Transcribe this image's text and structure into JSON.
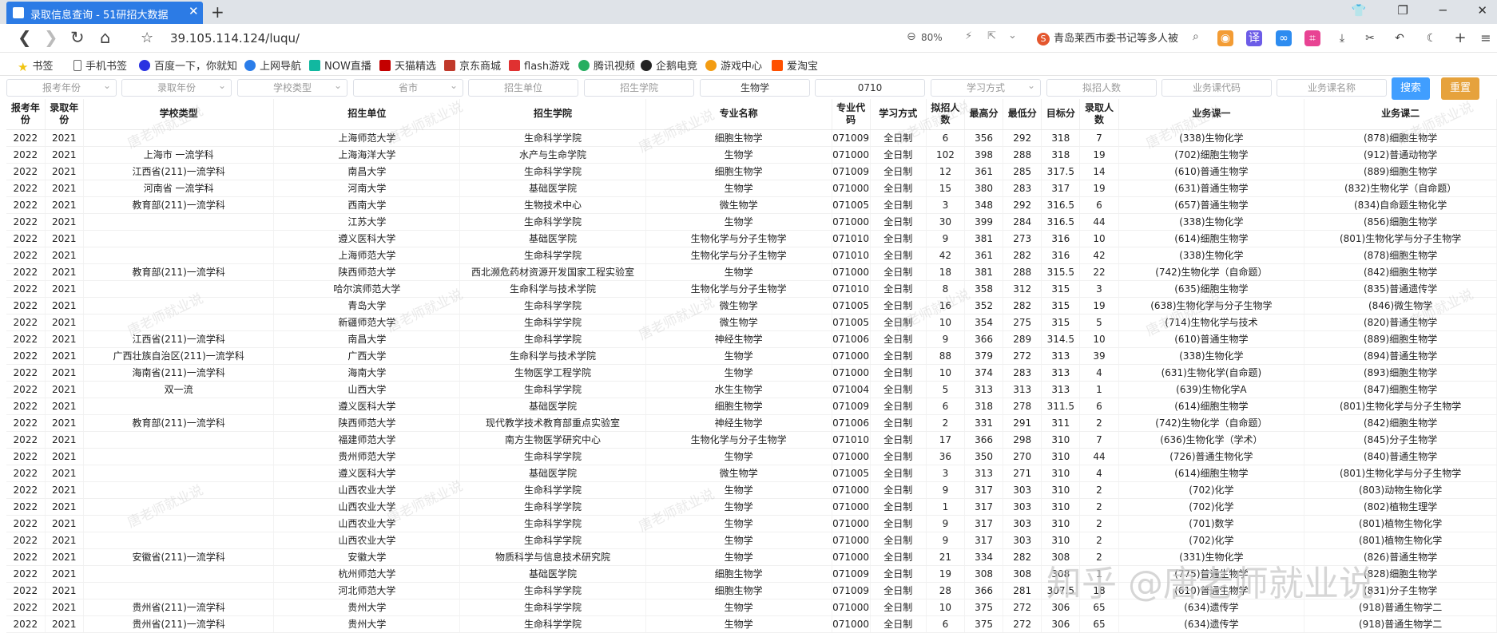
{
  "browser": {
    "tab_title": "录取信息查询 - 51研招大数据",
    "url": "39.105.114.124/luqu/",
    "zoom": "80%",
    "search_text": "青岛莱西市委书记等多人被"
  },
  "bookmarks": [
    "书签",
    "手机书签",
    "百度一下，你就知",
    "上网导航",
    "NOW直播",
    "天猫精选",
    "京东商城",
    "flash游戏",
    "腾讯视频",
    "企鹅电竞",
    "游戏中心",
    "爱淘宝"
  ],
  "filters": {
    "exam_year": "报考年份",
    "admit_year": "录取年份",
    "school_type": "学校类型",
    "province": "省市",
    "unit": "招生单位",
    "college": "招生学院",
    "major_name": "生物学",
    "major_code": "0710",
    "study_mode": "学习方式",
    "plan_count": "拟招人数",
    "course_code": "业务课代码",
    "course_name": "业务课名称",
    "search_btn": "搜索",
    "reset_btn": "重置"
  },
  "table": {
    "headers": [
      "报考年份",
      "录取年份",
      "学校类型",
      "招生单位",
      "招生学院",
      "专业名称",
      "专业代码",
      "学习方式",
      "拟招人数",
      "最高分",
      "最低分",
      "目标分",
      "录取人数",
      "业务课一",
      "业务课二"
    ],
    "rows": [
      [
        "2022",
        "2021",
        "",
        "上海师范大学",
        "生命科学学院",
        "细胞生物学",
        "071009",
        "全日制",
        "6",
        "356",
        "292",
        "318",
        "7",
        "(338)生物化学",
        "(878)细胞生物学"
      ],
      [
        "2022",
        "2021",
        "上海市 一流学科",
        "上海海洋大学",
        "水产与生命学院",
        "生物学",
        "071000",
        "全日制",
        "102",
        "398",
        "288",
        "318",
        "19",
        "(702)细胞生物学",
        "(912)普通动物学"
      ],
      [
        "2022",
        "2021",
        "江西省(211)一流学科",
        "南昌大学",
        "生命科学学院",
        "细胞生物学",
        "071009",
        "全日制",
        "12",
        "361",
        "285",
        "317.5",
        "14",
        "(610)普通生物学",
        "(889)细胞生物学"
      ],
      [
        "2022",
        "2021",
        "河南省 一流学科",
        "河南大学",
        "基础医学院",
        "生物学",
        "071000",
        "全日制",
        "15",
        "380",
        "283",
        "317",
        "19",
        "(631)普通生物学",
        "(832)生物化学（自命题）"
      ],
      [
        "2022",
        "2021",
        "教育部(211)一流学科",
        "西南大学",
        "生物技术中心",
        "微生物学",
        "071005",
        "全日制",
        "3",
        "348",
        "292",
        "316.5",
        "6",
        "(657)普通生物学",
        "(834)自命题生物化学"
      ],
      [
        "2022",
        "2021",
        "",
        "江苏大学",
        "生命科学学院",
        "生物学",
        "071000",
        "全日制",
        "30",
        "399",
        "284",
        "316.5",
        "44",
        "(338)生物化学",
        "(856)细胞生物学"
      ],
      [
        "2022",
        "2021",
        "",
        "遵义医科大学",
        "基础医学院",
        "生物化学与分子生物学",
        "071010",
        "全日制",
        "9",
        "381",
        "273",
        "316",
        "10",
        "(614)细胞生物学",
        "(801)生物化学与分子生物学"
      ],
      [
        "2022",
        "2021",
        "",
        "上海师范大学",
        "生命科学学院",
        "生物化学与分子生物学",
        "071010",
        "全日制",
        "42",
        "361",
        "282",
        "316",
        "42",
        "(338)生物化学",
        "(878)细胞生物学"
      ],
      [
        "2022",
        "2021",
        "教育部(211)一流学科",
        "陕西师范大学",
        "西北濒危药材资源开发国家工程实验室",
        "生物学",
        "071000",
        "全日制",
        "18",
        "381",
        "288",
        "315.5",
        "22",
        "(742)生物化学（自命题）",
        "(842)细胞生物学"
      ],
      [
        "2022",
        "2021",
        "",
        "哈尔滨师范大学",
        "生命科学与技术学院",
        "生物化学与分子生物学",
        "071010",
        "全日制",
        "8",
        "358",
        "312",
        "315",
        "3",
        "(635)细胞生物学",
        "(835)普通遗传学"
      ],
      [
        "2022",
        "2021",
        "",
        "青岛大学",
        "生命科学学院",
        "微生物学",
        "071005",
        "全日制",
        "16",
        "352",
        "282",
        "315",
        "19",
        "(638)生物化学与分子生物学",
        "(846)微生物学"
      ],
      [
        "2022",
        "2021",
        "",
        "新疆师范大学",
        "生命科学学院",
        "微生物学",
        "071005",
        "全日制",
        "10",
        "354",
        "275",
        "315",
        "5",
        "(714)生物化学与技术",
        "(820)普通生物学"
      ],
      [
        "2022",
        "2021",
        "江西省(211)一流学科",
        "南昌大学",
        "生命科学学院",
        "神经生物学",
        "071006",
        "全日制",
        "9",
        "366",
        "289",
        "314.5",
        "10",
        "(610)普通生物学",
        "(889)细胞生物学"
      ],
      [
        "2022",
        "2021",
        "广西壮族自治区(211)一流学科",
        "广西大学",
        "生命科学与技术学院",
        "生物学",
        "071000",
        "全日制",
        "88",
        "379",
        "272",
        "313",
        "39",
        "(338)生物化学",
        "(894)普通生物学"
      ],
      [
        "2022",
        "2021",
        "海南省(211)一流学科",
        "海南大学",
        "生物医学工程学院",
        "生物学",
        "071000",
        "全日制",
        "10",
        "374",
        "283",
        "313",
        "4",
        "(631)生物化学(自命题)",
        "(893)细胞生物学"
      ],
      [
        "2022",
        "2021",
        "双一流",
        "山西大学",
        "生命科学学院",
        "水生生物学",
        "071004",
        "全日制",
        "5",
        "313",
        "313",
        "313",
        "1",
        "(639)生物化学A",
        "(847)细胞生物学"
      ],
      [
        "2022",
        "2021",
        "",
        "遵义医科大学",
        "基础医学院",
        "细胞生物学",
        "071009",
        "全日制",
        "6",
        "318",
        "278",
        "311.5",
        "6",
        "(614)细胞生物学",
        "(801)生物化学与分子生物学"
      ],
      [
        "2022",
        "2021",
        "教育部(211)一流学科",
        "陕西师范大学",
        "现代教学技术教育部重点实验室",
        "神经生物学",
        "071006",
        "全日制",
        "2",
        "331",
        "291",
        "311",
        "2",
        "(742)生物化学（自命题）",
        "(842)细胞生物学"
      ],
      [
        "2022",
        "2021",
        "",
        "福建师范大学",
        "南方生物医学研究中心",
        "生物化学与分子生物学",
        "071010",
        "全日制",
        "17",
        "366",
        "298",
        "310",
        "7",
        "(636)生物化学（学术）",
        "(845)分子生物学"
      ],
      [
        "2022",
        "2021",
        "",
        "贵州师范大学",
        "生命科学学院",
        "生物学",
        "071000",
        "全日制",
        "36",
        "350",
        "270",
        "310",
        "44",
        "(726)普通生物化学",
        "(840)普通生物学"
      ],
      [
        "2022",
        "2021",
        "",
        "遵义医科大学",
        "基础医学院",
        "微生物学",
        "071005",
        "全日制",
        "3",
        "313",
        "271",
        "310",
        "4",
        "(614)细胞生物学",
        "(801)生物化学与分子生物学"
      ],
      [
        "2022",
        "2021",
        "",
        "山西农业大学",
        "生命科学学院",
        "生物学",
        "071000",
        "全日制",
        "9",
        "317",
        "303",
        "310",
        "2",
        "(702)化学",
        "(803)动物生物化学"
      ],
      [
        "2022",
        "2021",
        "",
        "山西农业大学",
        "生命科学学院",
        "生物学",
        "071000",
        "全日制",
        "1",
        "317",
        "303",
        "310",
        "2",
        "(702)化学",
        "(802)植物生理学"
      ],
      [
        "2022",
        "2021",
        "",
        "山西农业大学",
        "生命科学学院",
        "生物学",
        "071000",
        "全日制",
        "9",
        "317",
        "303",
        "310",
        "2",
        "(701)数学",
        "(801)植物生物化学"
      ],
      [
        "2022",
        "2021",
        "",
        "山西农业大学",
        "生命科学学院",
        "生物学",
        "071000",
        "全日制",
        "9",
        "317",
        "303",
        "310",
        "2",
        "(702)化学",
        "(801)植物生物化学"
      ],
      [
        "2022",
        "2021",
        "安徽省(211)一流学科",
        "安徽大学",
        "物质科学与信息技术研究院",
        "生物学",
        "071000",
        "全日制",
        "21",
        "334",
        "282",
        "308",
        "2",
        "(331)生物化学",
        "(826)普通生物学"
      ],
      [
        "2022",
        "2021",
        "",
        "杭州师范大学",
        "基础医学院",
        "细胞生物学",
        "071009",
        "全日制",
        "19",
        "308",
        "308",
        "308",
        "1",
        "(775)普通生物学",
        "(828)细胞生物学"
      ],
      [
        "2022",
        "2021",
        "",
        "河北师范大学",
        "生命科学学院",
        "细胞生物学",
        "071009",
        "全日制",
        "28",
        "366",
        "281",
        "307.5",
        "18",
        "(610)普通生物学",
        "(831)分子生物学"
      ],
      [
        "2022",
        "2021",
        "贵州省(211)一流学科",
        "贵州大学",
        "生命科学学院",
        "生物学",
        "071000",
        "全日制",
        "10",
        "375",
        "272",
        "306",
        "65",
        "(634)遗传学",
        "(918)普通生物学二"
      ],
      [
        "2022",
        "2021",
        "贵州省(211)一流学科",
        "贵州大学",
        "生命科学学院",
        "生物学",
        "071000",
        "全日制",
        "6",
        "375",
        "272",
        "306",
        "65",
        "(634)遗传学",
        "(918)普通生物学二"
      ]
    ]
  },
  "watermark": {
    "cell_text": "唐老师就业说",
    "corner_text": "知乎 @唐老师就业说"
  }
}
